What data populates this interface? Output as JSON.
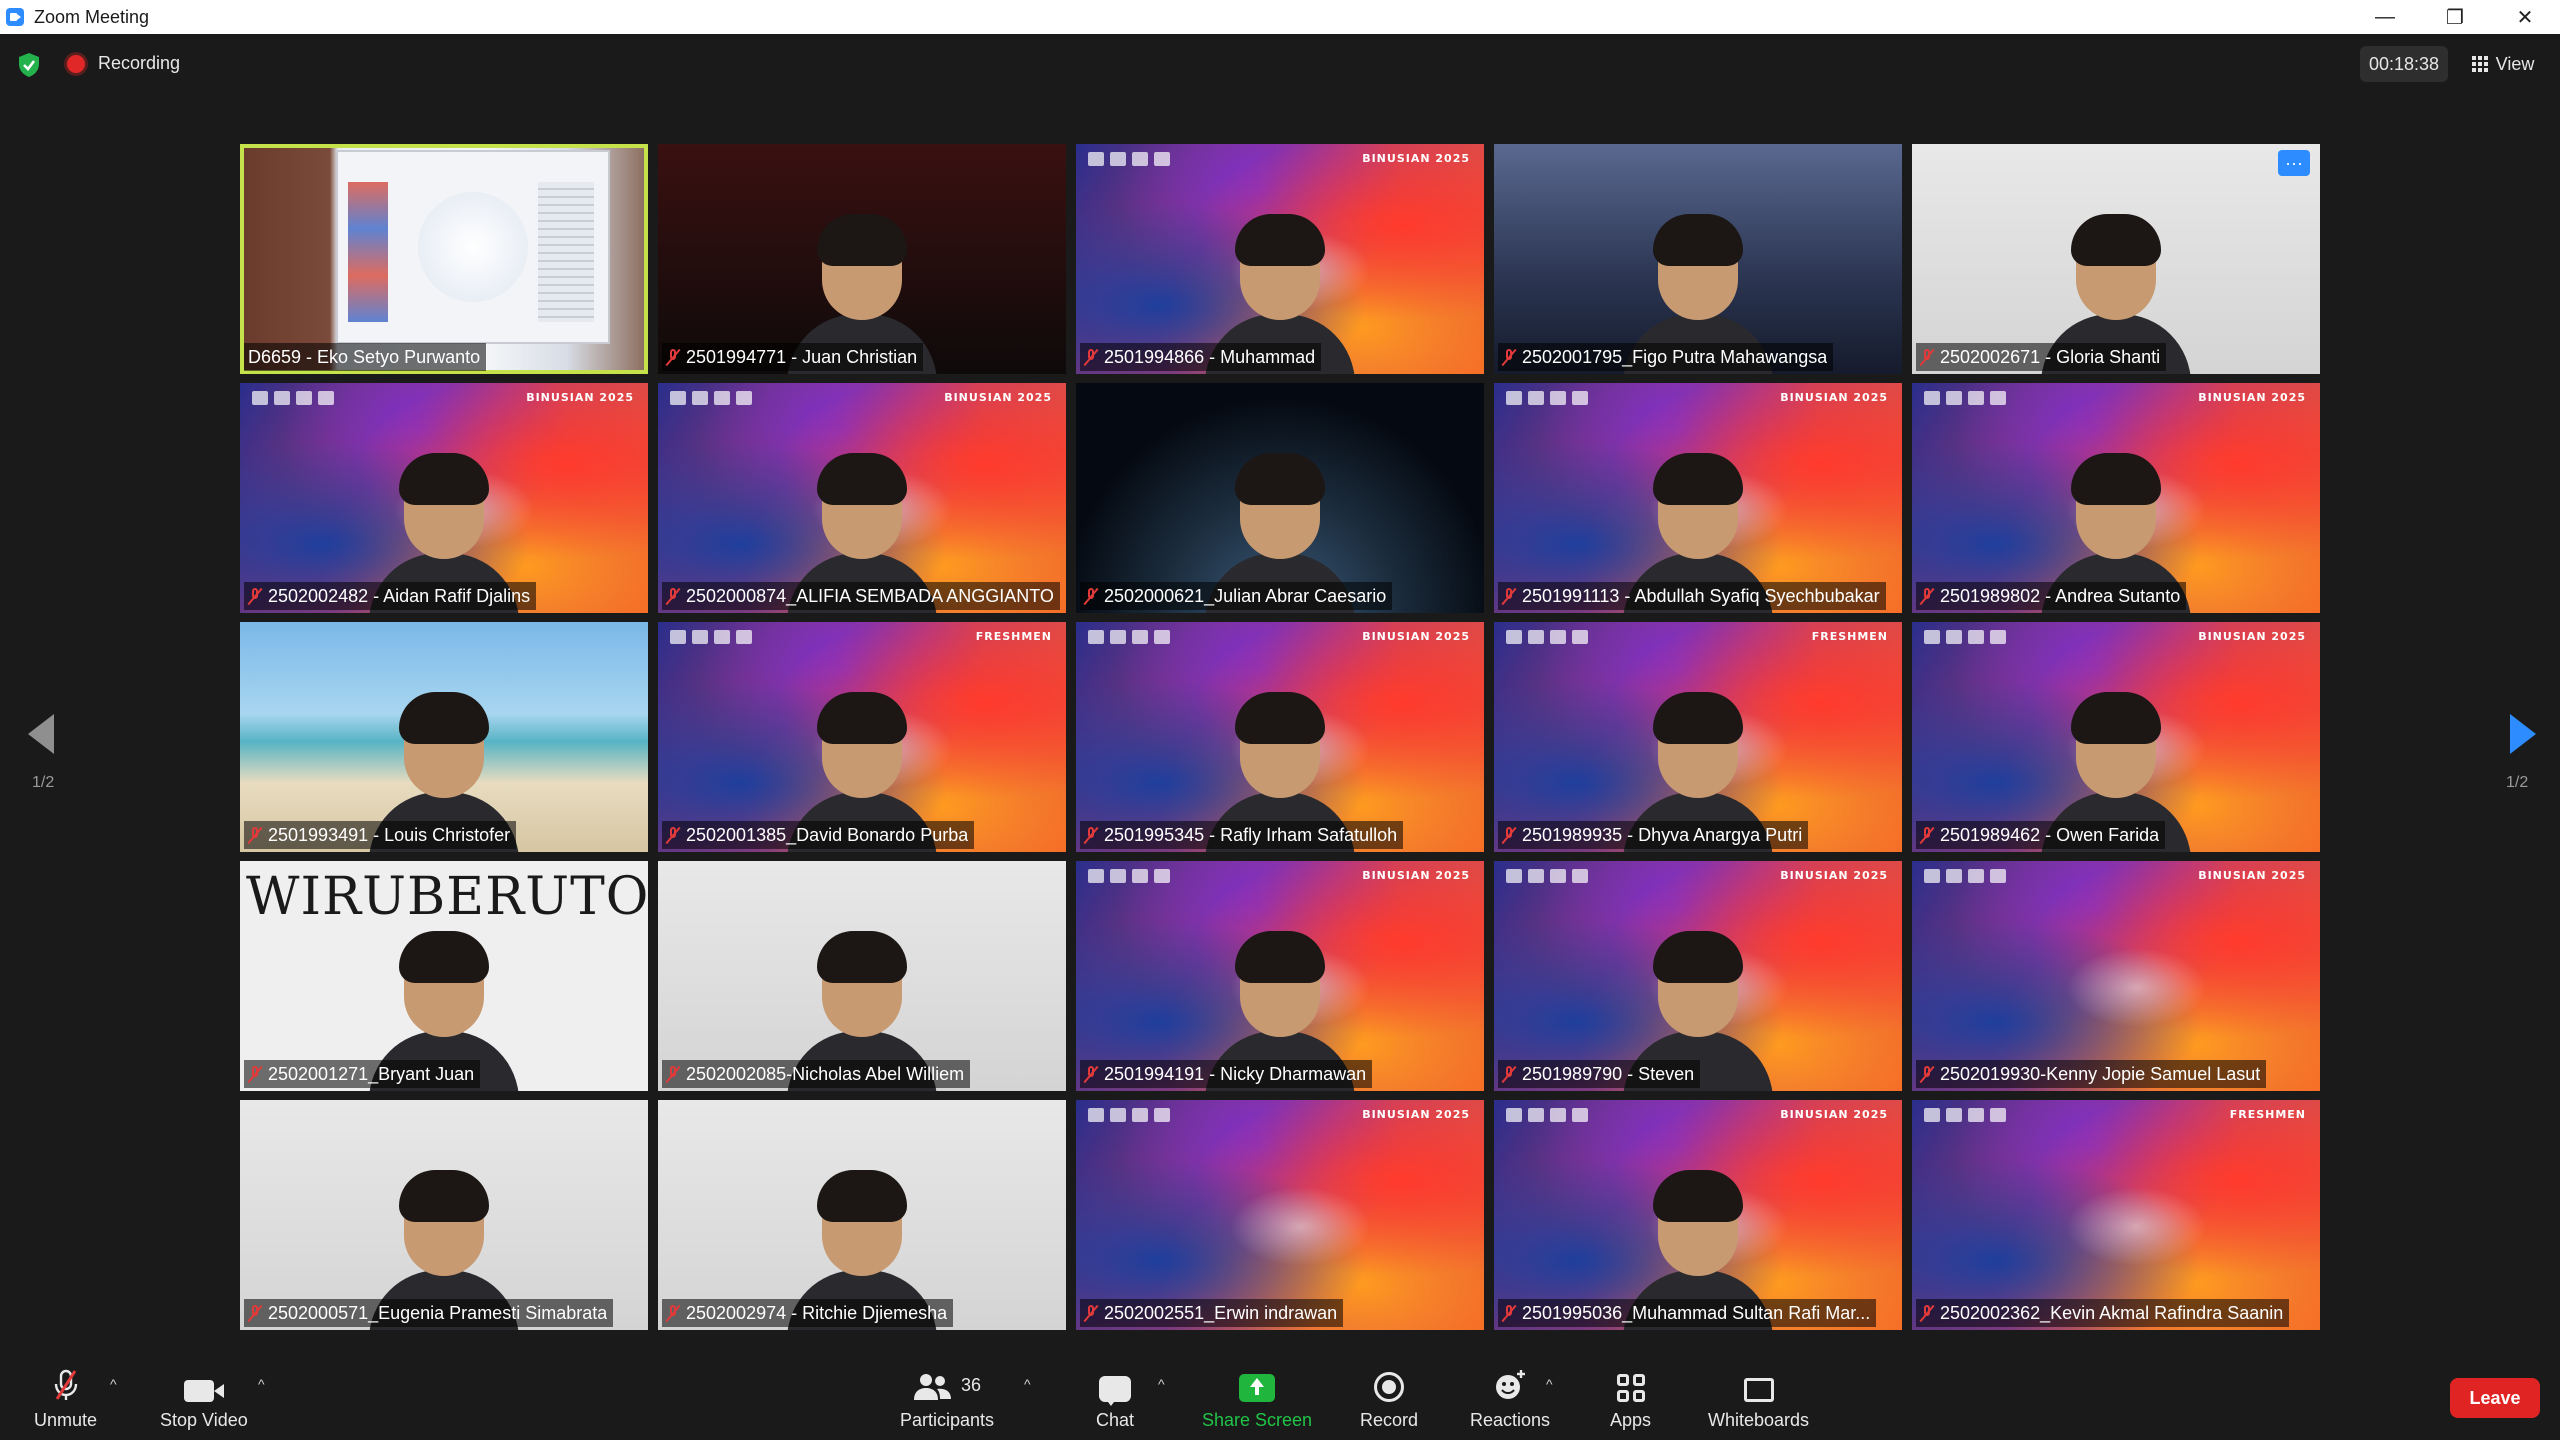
{
  "window": {
    "title": "Zoom Meeting",
    "controls": [
      "—",
      "❐",
      "✕"
    ]
  },
  "top": {
    "recording_label": "Recording",
    "timer": "00:18:38",
    "view_label": "View"
  },
  "gallery": {
    "page_left": "1/2",
    "page_right": "1/2",
    "tiles": [
      {
        "name": "D6659 - Eko Setyo Purwanto",
        "muted": false,
        "bg": "bg-screen",
        "active": true,
        "person": false
      },
      {
        "name": "2501994771 - Juan Christian",
        "muted": true,
        "bg": "bg-dark",
        "person": true
      },
      {
        "name": "2501994866 - Muhammad",
        "muted": true,
        "bg": "bg-binus",
        "brand": "BINUSIAN 2025",
        "person": true
      },
      {
        "name": "2502001795_Figo Putra Mahawangsa",
        "muted": true,
        "bg": "bg-arch",
        "person": true
      },
      {
        "name": "2502002671 - Gloria Shanti",
        "muted": true,
        "bg": "bg-white",
        "person": true,
        "more": "···"
      },
      {
        "name": "2502002482 - Aidan Rafif Djalins",
        "muted": true,
        "bg": "bg-binus",
        "brand": "BINUSIAN 2025",
        "person": true
      },
      {
        "name": "2502000874_ALIFIA SEMBADA ANGGIANTO",
        "muted": true,
        "bg": "bg-binus",
        "brand": "BINUSIAN 2025",
        "person": true
      },
      {
        "name": "2502000621_Julian Abrar Caesario",
        "muted": true,
        "bg": "bg-earth",
        "person": true
      },
      {
        "name": "2501991113 - Abdullah Syafiq Syechbubakar",
        "muted": true,
        "bg": "bg-binus",
        "brand": "BINUSIAN 2025",
        "person": true
      },
      {
        "name": "2501989802 - Andrea Sutanto",
        "muted": true,
        "bg": "bg-binus",
        "brand": "BINUSIAN 2025",
        "person": true
      },
      {
        "name": "2501993491 - Louis Christofer",
        "muted": true,
        "bg": "bg-beach",
        "person": true
      },
      {
        "name": "2502001385_David Bonardo Purba",
        "muted": true,
        "bg": "bg-binus",
        "brand": "FRESHMEN",
        "person": true
      },
      {
        "name": "2501995345 - Rafly Irham Safatulloh",
        "muted": true,
        "bg": "bg-binus",
        "brand": "BINUSIAN 2025",
        "person": true
      },
      {
        "name": "2501989935 - Dhyva Anargya Putri",
        "muted": true,
        "bg": "bg-binus",
        "brand": "FRESHMEN",
        "person": true
      },
      {
        "name": "2501989462 - Owen Farida",
        "muted": true,
        "bg": "bg-binus",
        "brand": "BINUSIAN 2025",
        "person": true
      },
      {
        "name": "2502001271_Bryant Juan",
        "muted": true,
        "bg": "bg-wiru",
        "overlay": "WIRUBERUTO",
        "person": true
      },
      {
        "name": "2502002085-Nicholas Abel Williem",
        "muted": true,
        "bg": "bg-white",
        "person": true
      },
      {
        "name": "2501994191 - Nicky Dharmawan",
        "muted": true,
        "bg": "bg-binus",
        "brand": "BINUSIAN 2025",
        "person": true
      },
      {
        "name": "2501989790 - Steven",
        "muted": true,
        "bg": "bg-binus",
        "brand": "BINUSIAN 2025",
        "person": true
      },
      {
        "name": "2502019930-Kenny Jopie Samuel Lasut",
        "muted": true,
        "bg": "bg-binus",
        "brand": "BINUSIAN 2025",
        "person": false
      },
      {
        "name": "2502000571_Eugenia Pramesti Simabrata",
        "muted": true,
        "bg": "bg-white",
        "person": true
      },
      {
        "name": "2502002974 - Ritchie Djiemesha",
        "muted": true,
        "bg": "bg-white",
        "person": true
      },
      {
        "name": "2502002551_Erwin indrawan",
        "muted": true,
        "bg": "bg-binus",
        "brand": "BINUSIAN 2025",
        "person": false
      },
      {
        "name": "2501995036_Muhammad Sultan Rafi Mar...",
        "muted": true,
        "bg": "bg-binus",
        "brand": "BINUSIAN 2025",
        "person": true
      },
      {
        "name": "2502002362_Kevin Akmal Rafindra Saanin",
        "muted": true,
        "bg": "bg-binus",
        "brand": "FRESHMEN",
        "person": false
      }
    ]
  },
  "toolbar": {
    "unmute": "Unmute",
    "stop_video": "Stop Video",
    "participants": "Participants",
    "participants_count": "36",
    "chat": "Chat",
    "share_screen": "Share Screen",
    "record": "Record",
    "reactions": "Reactions",
    "apps": "Apps",
    "whiteboards": "Whiteboards",
    "leave": "Leave",
    "caret": "^"
  },
  "colors": {
    "accent_blue": "#2d8cff",
    "share_green": "#20b53c",
    "leave_red": "#e02424",
    "active_speaker": "#c6e24a"
  }
}
